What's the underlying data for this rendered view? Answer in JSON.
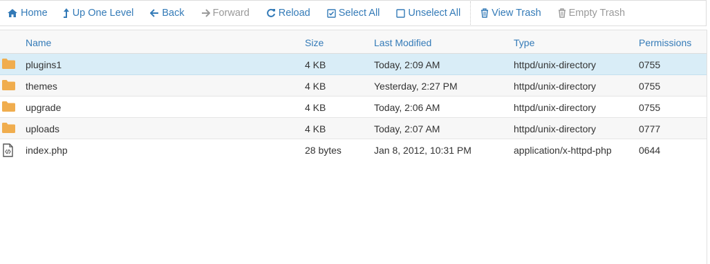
{
  "toolbar": {
    "home": "Home",
    "up": "Up One Level",
    "back": "Back",
    "forward": "Forward",
    "reload": "Reload",
    "select_all": "Select All",
    "unselect_all": "Unselect All",
    "view_trash": "View Trash",
    "empty_trash": "Empty Trash"
  },
  "columns": {
    "name": "Name",
    "size": "Size",
    "modified": "Last Modified",
    "type": "Type",
    "permissions": "Permissions"
  },
  "files": [
    {
      "icon": "folder-icon",
      "name": "plugins1",
      "size": "4 KB",
      "modified": "Today, 2:09 AM",
      "type": "httpd/unix-directory",
      "perm": "0755",
      "selected": true
    },
    {
      "icon": "folder-icon",
      "name": "themes",
      "size": "4 KB",
      "modified": "Yesterday, 2:27 PM",
      "type": "httpd/unix-directory",
      "perm": "0755",
      "selected": false
    },
    {
      "icon": "folder-icon",
      "name": "upgrade",
      "size": "4 KB",
      "modified": "Today, 2:06 AM",
      "type": "httpd/unix-directory",
      "perm": "0755",
      "selected": false
    },
    {
      "icon": "folder-icon",
      "name": "uploads",
      "size": "4 KB",
      "modified": "Today, 2:07 AM",
      "type": "httpd/unix-directory",
      "perm": "0777",
      "selected": false
    },
    {
      "icon": "code-file-icon",
      "name": "index.php",
      "size": "28 bytes",
      "modified": "Jan 8, 2012, 10:31 PM",
      "type": "application/x-httpd-php",
      "perm": "0644",
      "selected": false
    }
  ],
  "colors": {
    "link": "#337ab7",
    "disabled": "#999999",
    "selected_row": "#d9edf7",
    "folder": "#f0ad4e"
  }
}
